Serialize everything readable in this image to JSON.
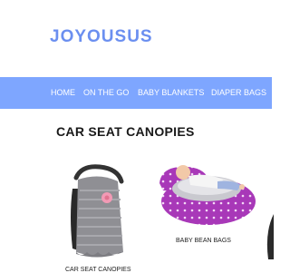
{
  "header": {
    "brand": "JOYOUSUS"
  },
  "nav": {
    "items": [
      {
        "label": "HOME"
      },
      {
        "label": "ON THE GO"
      },
      {
        "label": "BABY BLANKETS"
      },
      {
        "label": "DIAPER BAGS"
      }
    ]
  },
  "main": {
    "section_title": "CAR SEAT CANOPIES",
    "products": [
      {
        "caption": "CAR SEAT CANOPIES",
        "image_desc": "gray car seat canopy with pink flower"
      },
      {
        "caption": "BABY BEAN BAGS",
        "image_desc": "purple polka-dot baby bean bag with baby"
      }
    ]
  },
  "colors": {
    "brand": "#6b8ff0",
    "nav_bg": "#7ea6ff",
    "nav_text": "#ffffff",
    "title": "#1a1a1a"
  }
}
